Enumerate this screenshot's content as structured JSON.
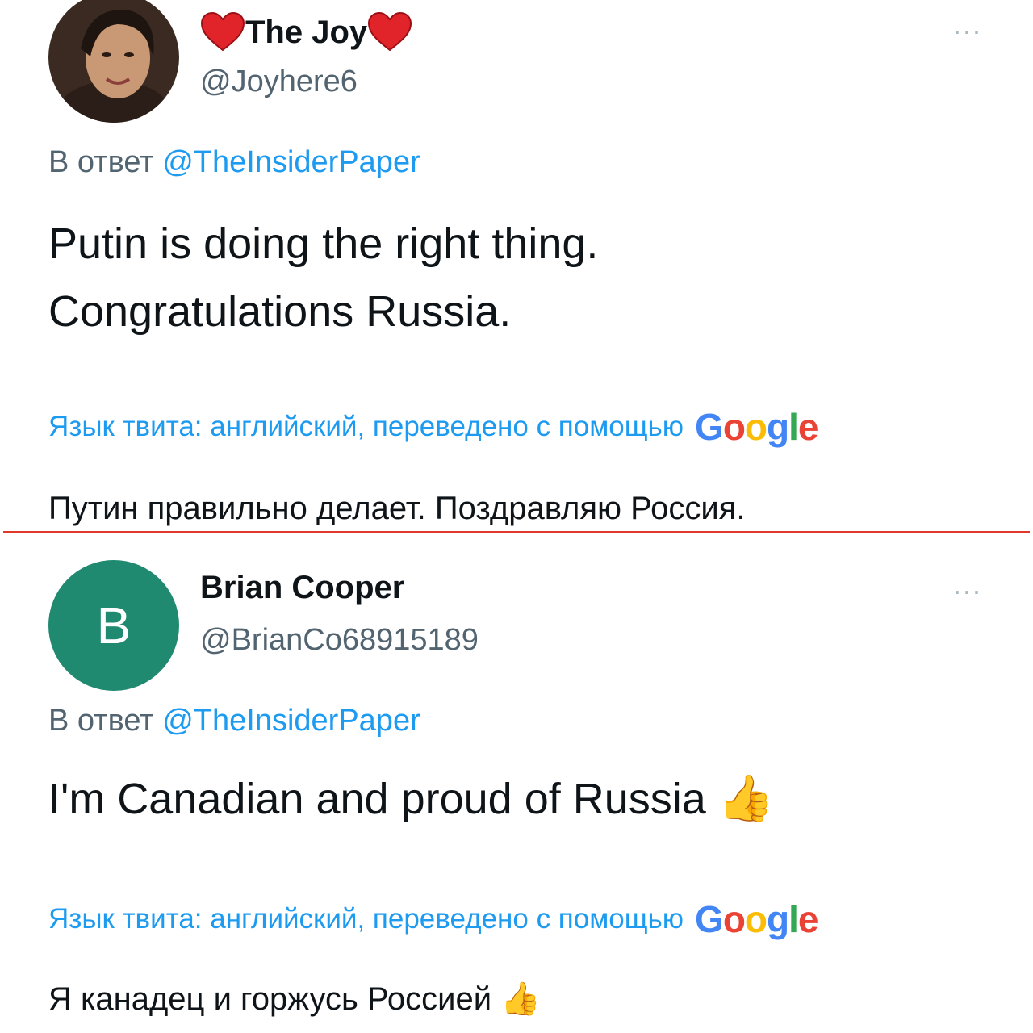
{
  "colors": {
    "link": "#1d9bf0",
    "secondary_text": "#536471",
    "divider": "#e0382b",
    "avatar_b": "#1f8a70"
  },
  "tweets": [
    {
      "display_name": "The Joy",
      "name_decoration_icon": "red-heart-icon",
      "handle": "@Joyhere6",
      "more_icon": "more-options-icon",
      "more_label": "···",
      "reply_prefix": "В ответ",
      "reply_mention": "@TheInsiderPaper",
      "text_line_1": "Putin is doing the right thing.",
      "text_line_2": "Congratulations Russia.",
      "translate_label": "Язык твита: английский, переведено с помощью",
      "translated_text": "Путин правильно делает. Поздравляю Россия."
    },
    {
      "avatar_letter": "B",
      "display_name": "Brian Cooper",
      "handle": "@BrianCo68915189",
      "more_label": "···",
      "reply_prefix": "В ответ",
      "reply_mention": "@TheInsiderPaper",
      "text": "I'm Canadian and proud of Russia",
      "text_emoji": "👍",
      "translate_label": "Язык твита: английский, переведено с помощью",
      "translated_text": "Я канадец и горжусь Россией",
      "translated_emoji": "👍"
    }
  ],
  "google_logo_letters": [
    "G",
    "o",
    "o",
    "g",
    "l",
    "e"
  ]
}
